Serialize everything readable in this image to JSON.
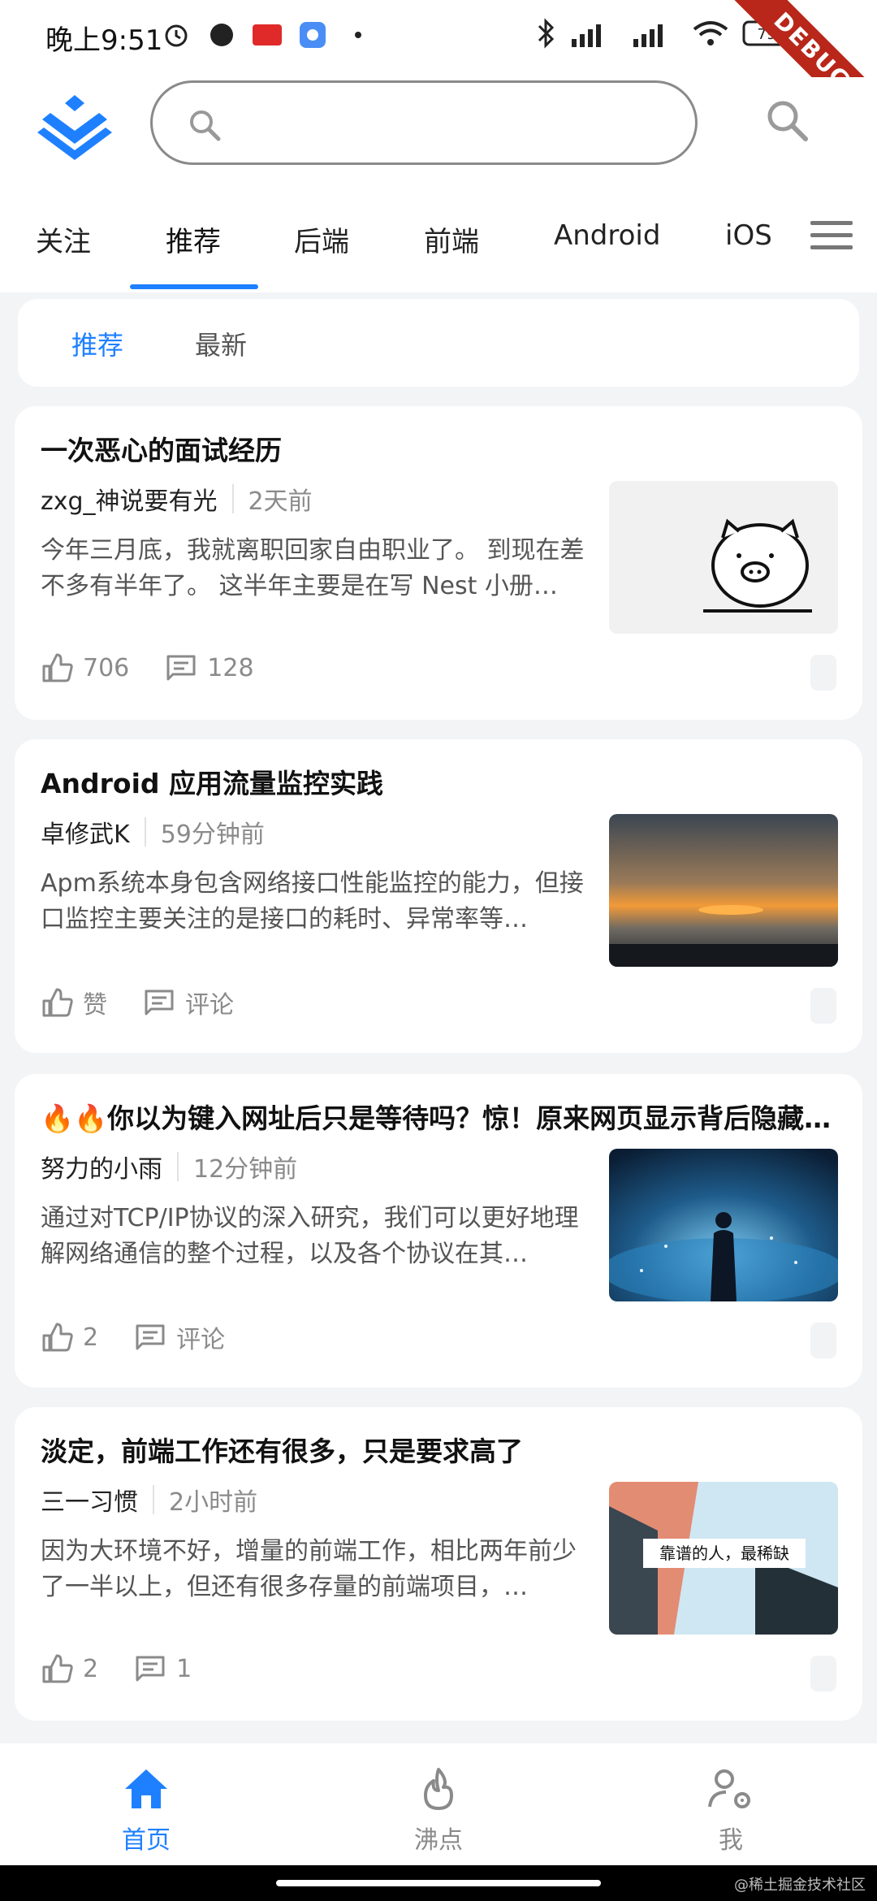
{
  "status_bar": {
    "time": "晚上9:51",
    "battery": "79",
    "debug_banner": "DEBUG"
  },
  "search": {
    "placeholder": ""
  },
  "tabs": [
    "关注",
    "推荐",
    "后端",
    "前端",
    "Android",
    "iOS"
  ],
  "active_tab": "推荐",
  "subtabs": [
    "推荐",
    "最新"
  ],
  "articles": [
    {
      "title": "一次恶心的面试经历",
      "author": "zxg_神说要有光",
      "time": "2天前",
      "summary": "今年三月底，我就离职回家自由职业了。 到现在差不多有半年了。 这半年主要是在写 Nest 小册…",
      "likes": "706",
      "comments": "128",
      "thumb": "pig-cartoon"
    },
    {
      "title": "Android 应用流量监控实践",
      "author": "卓修武K",
      "time": "59分钟前",
      "summary": "Apm系统本身包含网络接口性能监控的能力，但接口监控主要关注的是接口的耗时、异常率等…",
      "likes": "赞",
      "comments": "评论",
      "thumb": "sunset"
    },
    {
      "title": "🔥🔥你以为键入网址后只是等待吗？惊！原来网页显示背后隐藏…",
      "author": "努力的小雨",
      "time": "12分钟前",
      "summary": "通过对TCP/IP协议的深入研究，我们可以更好地理解网络通信的整个过程，以及各个协议在其…",
      "likes": "2",
      "comments": "评论",
      "thumb": "network-globe"
    },
    {
      "title": "淡定，前端工作还有很多，只是要求高了",
      "author": "三一习惯",
      "time": "2小时前",
      "summary": "因为大环境不好，增量的前端工作，相比两年前少了一半以上，但还有很多存量的前端项目，…",
      "likes": "2",
      "comments": "1",
      "thumb": "building",
      "thumb_text": "靠谱的人，最稀缺"
    }
  ],
  "bottom_nav": [
    "首页",
    "沸点",
    "我"
  ],
  "watermark": "@稀土掘金技术社区",
  "colors": {
    "accent": "#1e80ff",
    "background": "#f3f4f6",
    "debug": "#b8271a"
  }
}
